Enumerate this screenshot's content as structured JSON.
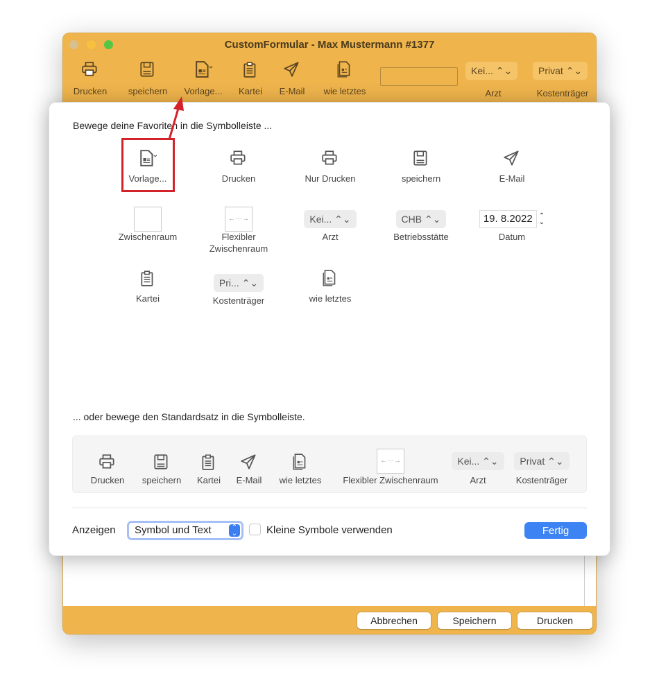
{
  "window": {
    "title": "CustomFormular -  Max Mustermann #1377",
    "toolbar": [
      {
        "label": "Drucken",
        "icon": "printer"
      },
      {
        "label": "speichern",
        "icon": "floppy"
      },
      {
        "label": "Vorlage...",
        "icon": "template"
      },
      {
        "label": "Kartei",
        "icon": "clipboard"
      },
      {
        "label": "E-Mail",
        "icon": "paperplane"
      },
      {
        "label": "wie letztes",
        "icon": "docs"
      }
    ],
    "arzt": {
      "value": "Kei...",
      "label": "Arzt"
    },
    "kostentraeger": {
      "value": "Privat",
      "label": "Kostenträger"
    },
    "buttons": {
      "cancel": "Abbrechen",
      "save": "Speichern",
      "print": "Drucken"
    },
    "accent": "#efb44c"
  },
  "sheet": {
    "heading1": "Bewege deine Favoriten in die Symbolleiste ...",
    "palette": [
      {
        "label": "Vorlage...",
        "kind": "icon",
        "icon": "template"
      },
      {
        "label": "Drucken",
        "kind": "icon",
        "icon": "printer"
      },
      {
        "label": "Nur Drucken",
        "kind": "icon",
        "icon": "printer"
      },
      {
        "label": "speichern",
        "kind": "icon",
        "icon": "floppy"
      },
      {
        "label": "E-Mail",
        "kind": "icon",
        "icon": "paperplane"
      },
      {
        "label": "Zwischenraum",
        "kind": "space"
      },
      {
        "label": "Flexibler Zwischenraum",
        "kind": "flex"
      },
      {
        "label": "Arzt",
        "kind": "popup",
        "value": "Kei..."
      },
      {
        "label": "Betriebsstätte",
        "kind": "popup",
        "value": "CHB"
      },
      {
        "label": "Datum",
        "kind": "date",
        "value": "19.  8.2022"
      },
      {
        "label": "Kartei",
        "kind": "icon",
        "icon": "clipboard"
      },
      {
        "label": "Kostenträger",
        "kind": "popup",
        "value": "Pri..."
      },
      {
        "label": "wie letztes",
        "kind": "icon",
        "icon": "docs"
      }
    ],
    "heading2": "... oder bewege den Standardsatz in die Symbolleiste.",
    "default_set": [
      {
        "label": "Drucken",
        "kind": "icon",
        "icon": "printer"
      },
      {
        "label": "speichern",
        "kind": "icon",
        "icon": "floppy"
      },
      {
        "label": "Kartei",
        "kind": "icon",
        "icon": "clipboard"
      },
      {
        "label": "E-Mail",
        "kind": "icon",
        "icon": "paperplane"
      },
      {
        "label": "wie letztes",
        "kind": "icon",
        "icon": "docs"
      },
      {
        "label": "Flexibler Zwischenraum",
        "kind": "flex"
      },
      {
        "label": "Arzt",
        "kind": "popup",
        "value": "Kei..."
      },
      {
        "label": "Kostenträger",
        "kind": "popup",
        "value": "Privat"
      }
    ],
    "show_label": "Anzeigen",
    "show_value": "Symbol und Text",
    "small_icons_label": "Kleine Symbole verwenden",
    "small_icons_checked": false,
    "done": "Fertig",
    "highlight_color": "#d3222a",
    "done_color": "#3d83f3"
  }
}
